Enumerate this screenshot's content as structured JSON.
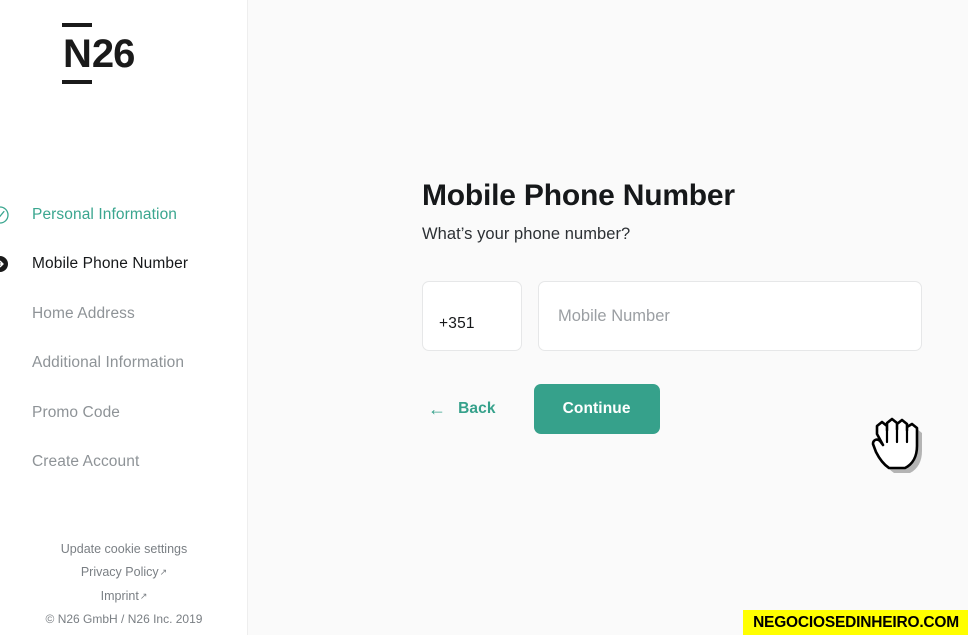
{
  "brand": {
    "logo_n": "N",
    "logo_rest": "26"
  },
  "sidebar": {
    "items": [
      {
        "label": "Personal Information",
        "state": "done",
        "icon": "check-circle-icon"
      },
      {
        "label": "Mobile Phone Number",
        "state": "active",
        "icon": "arrow-right-filled-icon"
      },
      {
        "label": "Home Address",
        "state": "pending",
        "icon": ""
      },
      {
        "label": "Additional Information",
        "state": "pending",
        "icon": ""
      },
      {
        "label": "Promo Code",
        "state": "pending",
        "icon": ""
      },
      {
        "label": "Create Account",
        "state": "pending",
        "icon": ""
      }
    ],
    "footer": {
      "cookie_settings": "Update cookie settings",
      "privacy_policy": "Privacy Policy",
      "imprint": "Imprint",
      "external_arrow": "↗",
      "copyright": "© N26 GmbH / N26 Inc. 2019"
    }
  },
  "main": {
    "title": "Mobile Phone Number",
    "subtitle": "What’s your phone number?",
    "country_code": "+351",
    "number_placeholder": "Mobile Number",
    "number_value": "",
    "back_label": "Back",
    "back_arrow": "←",
    "continue_label": "Continue"
  },
  "watermark": {
    "text": "NEGOCIOSEDINHEIRO.COM"
  },
  "colors": {
    "accent": "#36a18b",
    "done": "#3aa68f",
    "text": "#16181a",
    "muted": "#8e9397",
    "watermark_bg": "#ffff00"
  }
}
